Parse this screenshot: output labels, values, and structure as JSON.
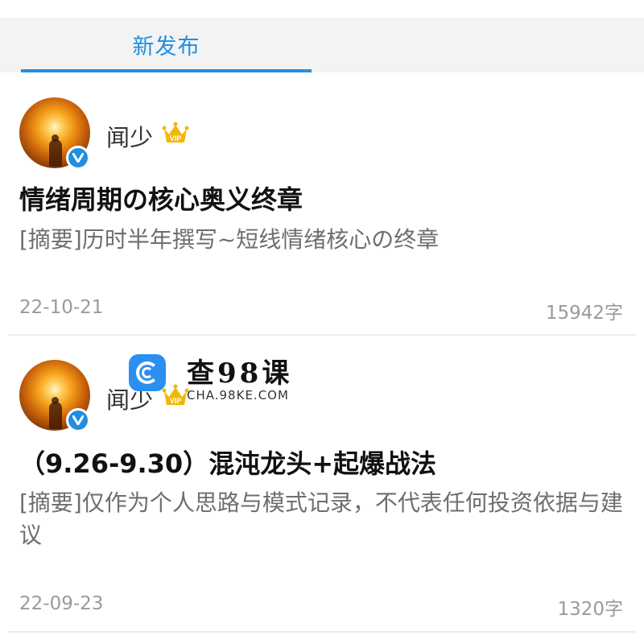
{
  "tabs": [
    {
      "label": "新发布"
    }
  ],
  "posts": [
    {
      "author": "闻少",
      "title": "情绪周期の核心奥义终章",
      "summary": "[摘要]历时半年撰写~短线情绪核心の终章",
      "date": "22-10-21",
      "word_count": "15942字"
    },
    {
      "author": "闻少",
      "title": "（9.26-9.30）混沌龙头+起爆战法",
      "summary": "[摘要]仅作为个人思路与模式记录，不代表任何投资依据与建议",
      "date": "22-09-23",
      "word_count": "1320字"
    }
  ],
  "watermark": {
    "text": "查98课",
    "url": "CHA.98KE.COM"
  },
  "colors": {
    "accent": "#1f8fe0",
    "tab_bar_bg": "#f3f3f3",
    "vip_gold": "#f2b705"
  },
  "icons": {
    "verified": "verified-badge-icon",
    "vip": "vip-crown-icon",
    "watermark_logo": "search-logo-icon"
  }
}
